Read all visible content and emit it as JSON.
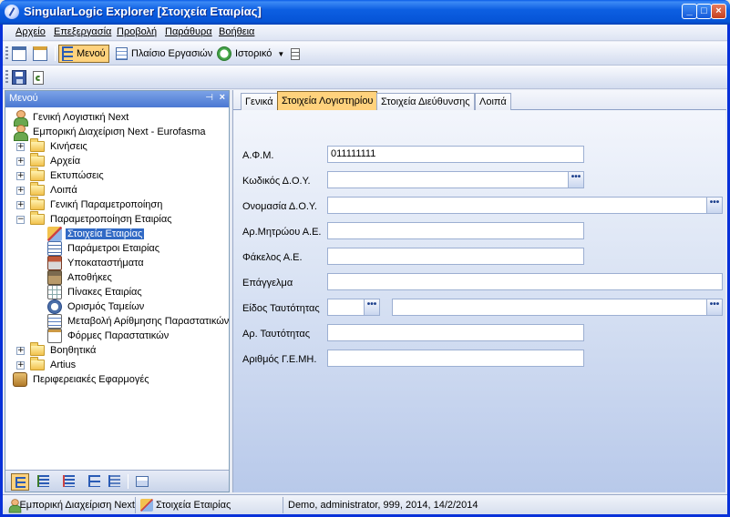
{
  "window": {
    "title": "SingularLogic Explorer [Στοιχεία Εταιρίας]",
    "controls": {
      "minimize": "_",
      "maximize": "□",
      "close": "×"
    }
  },
  "menubar": {
    "items": [
      "Αρχείο",
      "Επεξεργασία",
      "Προβολή",
      "Παράθυρα",
      "Βοήθεια"
    ]
  },
  "toolbar": {
    "menu_label": "Μενού",
    "taskbox_label": "Πλαίσιο Εργασιών",
    "history_label": "Ιστορικό"
  },
  "left_pane": {
    "title": "Μενού",
    "pin_icon": "pin-icon",
    "close_glyph": "×",
    "tree": [
      {
        "label": "Γενική Λογιστική Next",
        "icon": "person-icon",
        "expander": ""
      },
      {
        "label": "Εμπορική Διαχείριση Next - Eurofasma",
        "icon": "person-icon",
        "expander": ""
      },
      {
        "label": "Κινήσεις",
        "icon": "folder-icon",
        "expander": "+"
      },
      {
        "label": "Αρχεία",
        "icon": "folder-icon",
        "expander": "+"
      },
      {
        "label": "Εκτυπώσεις",
        "icon": "folder-icon",
        "expander": "+"
      },
      {
        "label": "Λοιπά",
        "icon": "folder-icon",
        "expander": "+"
      },
      {
        "label": "Γενική Παραμετροποίηση",
        "icon": "folder-icon",
        "expander": "+"
      },
      {
        "label": "Παραμετροποίηση Εταιρίας",
        "icon": "folder-open-icon",
        "expander": "−"
      },
      {
        "label": "Στοιχεία Εταιρίας",
        "icon": "company-icon",
        "selected": true
      },
      {
        "label": "Παράμετροι Εταιρίας",
        "icon": "parameters-icon"
      },
      {
        "label": "Υποκαταστήματα",
        "icon": "branches-icon"
      },
      {
        "label": "Αποθήκες",
        "icon": "warehouse-icon"
      },
      {
        "label": "Πίνακες Εταιρίας",
        "icon": "tables-icon"
      },
      {
        "label": "Ορισμός Ταμείων",
        "icon": "cashbox-icon"
      },
      {
        "label": "Μεταβολή Αρίθμησης Παραστατικών",
        "icon": "numbering-icon"
      },
      {
        "label": "Φόρμες Παραστατικών",
        "icon": "forms-icon"
      },
      {
        "label": "Βοηθητικά",
        "icon": "folder-icon",
        "expander": "+"
      },
      {
        "label": "Artius",
        "icon": "folder-icon",
        "expander": "+"
      },
      {
        "label": "Περιφερειακές Εφαρμογές",
        "icon": "peripheral-icon",
        "expander": ""
      }
    ]
  },
  "tabs": [
    "Γενικά",
    "Στοιχεία Λογιστηρίου",
    "Στοιχεία Διεύθυνσης",
    "Λοιπά"
  ],
  "active_tab_index": 1,
  "form": {
    "afm_label": "Α.Φ.Μ.",
    "afm_value": "011111111",
    "doy_code_label": "Κωδικός Δ.Ο.Υ.",
    "doy_code_value": "",
    "doy_name_label": "Ονομασία Δ.Ο.Υ.",
    "doy_name_value": "",
    "registry_label": "Αρ.Μητρώου Α.Ε.",
    "registry_value": "",
    "folder_label": "Φάκελος Α.Ε.",
    "folder_value": "",
    "profession_label": "Επάγγελμα",
    "profession_value": "",
    "id_type_label": "Είδος Ταυτότητας",
    "id_type_code": "",
    "id_type_desc": "",
    "id_number_label": "Αρ. Ταυτότητας",
    "id_number_value": "",
    "gemi_label": "Αριθμός Γ.Ε.ΜΗ.",
    "gemi_value": "",
    "lookup_glyph": "•••"
  },
  "statusbar": {
    "app": "Εμπορική Διαχείριση Next",
    "screen": "Στοιχεία Εταιρίας",
    "session": "Demo, administrator, 999, 2014, 14/2/2014"
  },
  "colors": {
    "title_blue": "#0654d6",
    "active_highlight": "#ffd27d",
    "selection_blue": "#316ac5"
  }
}
